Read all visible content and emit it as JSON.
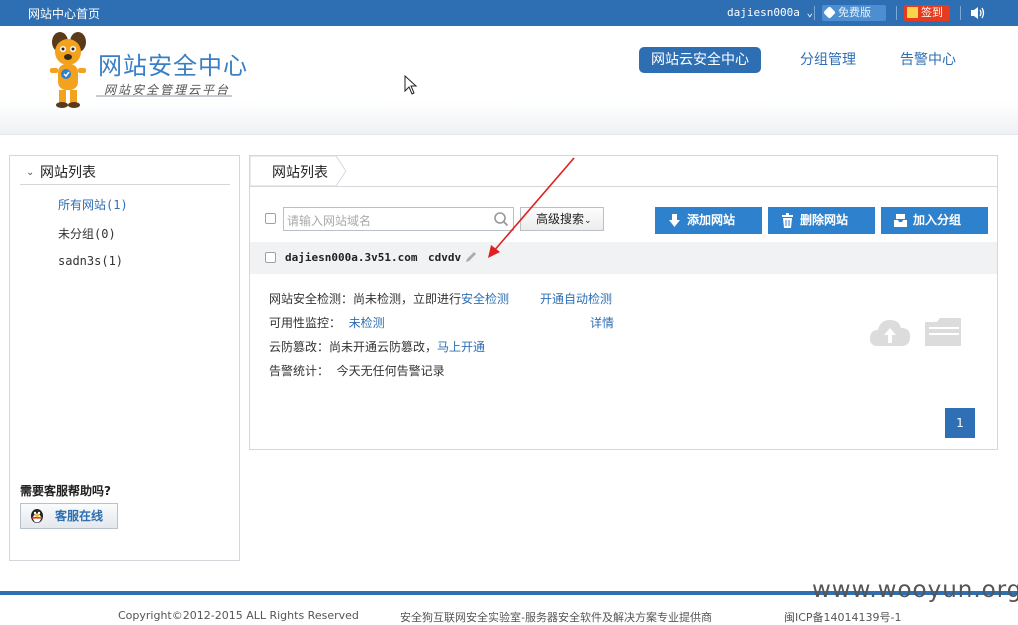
{
  "topbar": {
    "home_label": "网站中心首页",
    "username": "dajiesn000a",
    "free_label": "免费版",
    "sign_label": "签到"
  },
  "header": {
    "brand_title": "网站安全中心",
    "brand_subtitle": "网站安全管理云平台",
    "nav": [
      {
        "label": "网站云安全中心",
        "active": true
      },
      {
        "label": "分组管理",
        "active": false
      },
      {
        "label": "告警中心",
        "active": false
      }
    ]
  },
  "sidebar": {
    "title": "网站列表",
    "items": [
      {
        "label": "所有网站(1)",
        "active": true
      },
      {
        "label": "未分组(0)",
        "active": false
      },
      {
        "label": "sadn3s(1)",
        "active": false
      }
    ],
    "help_label": "需要客服帮助吗?",
    "kefu_label": "客服在线"
  },
  "main": {
    "tab_label": "网站列表",
    "search_placeholder": "请输入网站域名",
    "advanced_search_label": "高级搜索",
    "add_site_label": "添加网站",
    "delete_site_label": "删除网站",
    "add_group_label": "加入分组",
    "site": {
      "domain": "dajiesn000a.3v51.com",
      "alias": "cdvdv",
      "security_check_label": "网站安全检测：尚未检测，立即进行",
      "security_check_link": "安全检测",
      "auto_check_link": "开通自动检测",
      "availability_label": "可用性监控：",
      "availability_status": "未检测",
      "details_link": "详情",
      "tamper_label": "云防篡改：尚未开通云防篡改，",
      "tamper_link": "马上开通",
      "alert_label": "告警统计：",
      "alert_value": "今天无任何告警记录"
    },
    "page_current": "1"
  },
  "footer": {
    "copyright": "Copyright©2012-2015 ALL Rights Reserved",
    "company": "安全狗互联网安全实验室-服务器安全软件及解决方案专业提供商",
    "icp": "闽ICP备14014139号-1",
    "watermark": "www.wooyun.org"
  },
  "colors": {
    "primary": "#2e6fb3",
    "button": "#2e81cd",
    "sign": "#e63b1c"
  }
}
